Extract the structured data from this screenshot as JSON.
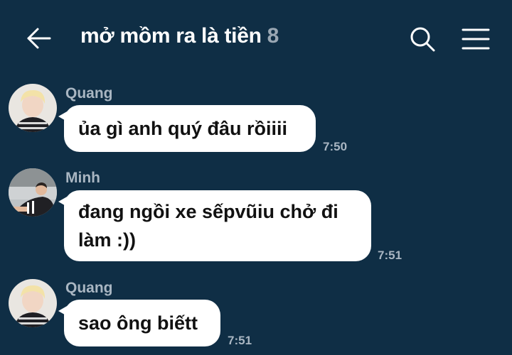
{
  "header": {
    "title": "mở mồm ra là tiền",
    "member_count": "8",
    "back_icon": "arrow-left-icon",
    "search_icon": "search-icon",
    "menu_icon": "hamburger-menu-icon"
  },
  "messages": [
    {
      "sender": "Quang",
      "text": "ủa gì anh quý đâu rồiiii",
      "time": "7:50"
    },
    {
      "sender": "Minh",
      "text_line1": "đang ngồi xe sếpvũiu chở đi",
      "text_line2": "làm :))",
      "time": "7:51"
    },
    {
      "sender": "Quang",
      "text": "sao ông biếtt",
      "time": "7:51"
    }
  ],
  "colors": {
    "background": "#0f2e45",
    "bubble": "#ffffff",
    "meta_text": "#a9b6c2"
  }
}
